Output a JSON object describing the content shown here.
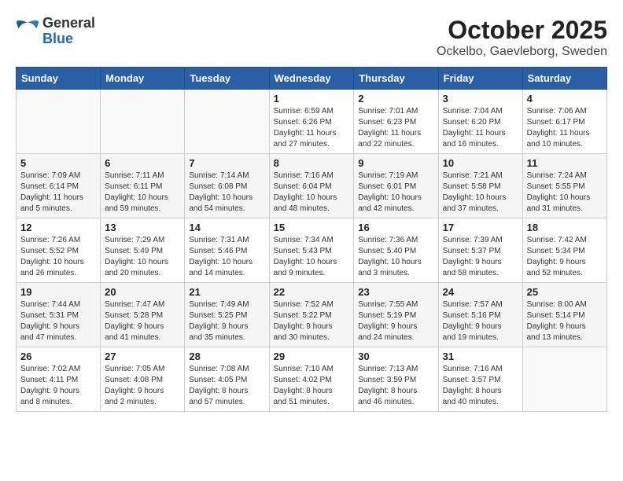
{
  "header": {
    "logo_general": "General",
    "logo_blue": "Blue",
    "month": "October 2025",
    "location": "Ockelbo, Gaevleborg, Sweden"
  },
  "days_of_week": [
    "Sunday",
    "Monday",
    "Tuesday",
    "Wednesday",
    "Thursday",
    "Friday",
    "Saturday"
  ],
  "weeks": [
    [
      {
        "day": "",
        "info": ""
      },
      {
        "day": "",
        "info": ""
      },
      {
        "day": "",
        "info": ""
      },
      {
        "day": "1",
        "info": "Sunrise: 6:59 AM\nSunset: 6:26 PM\nDaylight: 11 hours\nand 27 minutes."
      },
      {
        "day": "2",
        "info": "Sunrise: 7:01 AM\nSunset: 6:23 PM\nDaylight: 11 hours\nand 22 minutes."
      },
      {
        "day": "3",
        "info": "Sunrise: 7:04 AM\nSunset: 6:20 PM\nDaylight: 11 hours\nand 16 minutes."
      },
      {
        "day": "4",
        "info": "Sunrise: 7:06 AM\nSunset: 6:17 PM\nDaylight: 11 hours\nand 10 minutes."
      }
    ],
    [
      {
        "day": "5",
        "info": "Sunrise: 7:09 AM\nSunset: 6:14 PM\nDaylight: 11 hours\nand 5 minutes."
      },
      {
        "day": "6",
        "info": "Sunrise: 7:11 AM\nSunset: 6:11 PM\nDaylight: 10 hours\nand 59 minutes."
      },
      {
        "day": "7",
        "info": "Sunrise: 7:14 AM\nSunset: 6:08 PM\nDaylight: 10 hours\nand 54 minutes."
      },
      {
        "day": "8",
        "info": "Sunrise: 7:16 AM\nSunset: 6:04 PM\nDaylight: 10 hours\nand 48 minutes."
      },
      {
        "day": "9",
        "info": "Sunrise: 7:19 AM\nSunset: 6:01 PM\nDaylight: 10 hours\nand 42 minutes."
      },
      {
        "day": "10",
        "info": "Sunrise: 7:21 AM\nSunset: 5:58 PM\nDaylight: 10 hours\nand 37 minutes."
      },
      {
        "day": "11",
        "info": "Sunrise: 7:24 AM\nSunset: 5:55 PM\nDaylight: 10 hours\nand 31 minutes."
      }
    ],
    [
      {
        "day": "12",
        "info": "Sunrise: 7:26 AM\nSunset: 5:52 PM\nDaylight: 10 hours\nand 26 minutes."
      },
      {
        "day": "13",
        "info": "Sunrise: 7:29 AM\nSunset: 5:49 PM\nDaylight: 10 hours\nand 20 minutes."
      },
      {
        "day": "14",
        "info": "Sunrise: 7:31 AM\nSunset: 5:46 PM\nDaylight: 10 hours\nand 14 minutes."
      },
      {
        "day": "15",
        "info": "Sunrise: 7:34 AM\nSunset: 5:43 PM\nDaylight: 10 hours\nand 9 minutes."
      },
      {
        "day": "16",
        "info": "Sunrise: 7:36 AM\nSunset: 5:40 PM\nDaylight: 10 hours\nand 3 minutes."
      },
      {
        "day": "17",
        "info": "Sunrise: 7:39 AM\nSunset: 5:37 PM\nDaylight: 9 hours\nand 58 minutes."
      },
      {
        "day": "18",
        "info": "Sunrise: 7:42 AM\nSunset: 5:34 PM\nDaylight: 9 hours\nand 52 minutes."
      }
    ],
    [
      {
        "day": "19",
        "info": "Sunrise: 7:44 AM\nSunset: 5:31 PM\nDaylight: 9 hours\nand 47 minutes."
      },
      {
        "day": "20",
        "info": "Sunrise: 7:47 AM\nSunset: 5:28 PM\nDaylight: 9 hours\nand 41 minutes."
      },
      {
        "day": "21",
        "info": "Sunrise: 7:49 AM\nSunset: 5:25 PM\nDaylight: 9 hours\nand 35 minutes."
      },
      {
        "day": "22",
        "info": "Sunrise: 7:52 AM\nSunset: 5:22 PM\nDaylight: 9 hours\nand 30 minutes."
      },
      {
        "day": "23",
        "info": "Sunrise: 7:55 AM\nSunset: 5:19 PM\nDaylight: 9 hours\nand 24 minutes."
      },
      {
        "day": "24",
        "info": "Sunrise: 7:57 AM\nSunset: 5:16 PM\nDaylight: 9 hours\nand 19 minutes."
      },
      {
        "day": "25",
        "info": "Sunrise: 8:00 AM\nSunset: 5:14 PM\nDaylight: 9 hours\nand 13 minutes."
      }
    ],
    [
      {
        "day": "26",
        "info": "Sunrise: 7:02 AM\nSunset: 4:11 PM\nDaylight: 9 hours\nand 8 minutes."
      },
      {
        "day": "27",
        "info": "Sunrise: 7:05 AM\nSunset: 4:08 PM\nDaylight: 9 hours\nand 2 minutes."
      },
      {
        "day": "28",
        "info": "Sunrise: 7:08 AM\nSunset: 4:05 PM\nDaylight: 8 hours\nand 57 minutes."
      },
      {
        "day": "29",
        "info": "Sunrise: 7:10 AM\nSunset: 4:02 PM\nDaylight: 8 hours\nand 51 minutes."
      },
      {
        "day": "30",
        "info": "Sunrise: 7:13 AM\nSunset: 3:59 PM\nDaylight: 8 hours\nand 46 minutes."
      },
      {
        "day": "31",
        "info": "Sunrise: 7:16 AM\nSunset: 3:57 PM\nDaylight: 8 hours\nand 40 minutes."
      },
      {
        "day": "",
        "info": ""
      }
    ]
  ]
}
